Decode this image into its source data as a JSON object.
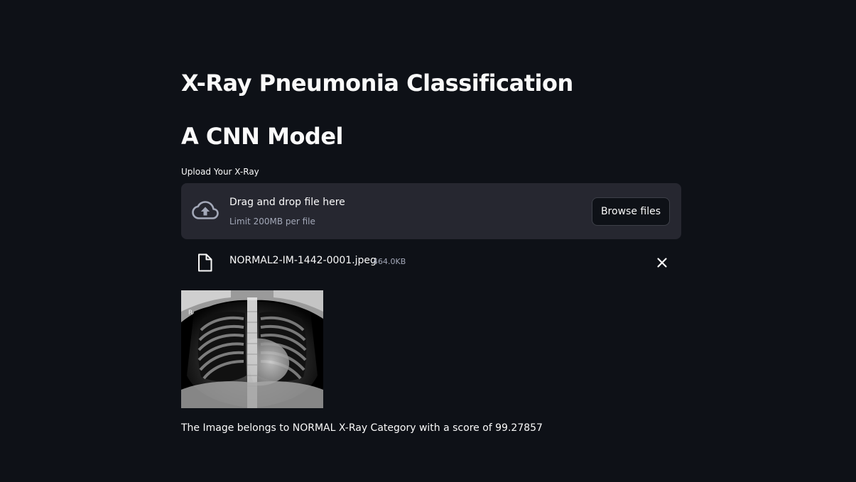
{
  "page": {
    "title": "X-Ray Pneumonia Classification",
    "subtitle": "A CNN Model"
  },
  "uploader": {
    "label": "Upload Your X-Ray",
    "drop_text": "Drag and drop file here",
    "limit_text": "Limit 200MB per file",
    "browse_label": "Browse files",
    "icon": "cloud-upload-icon"
  },
  "uploaded_file": {
    "name": "NORMAL2-IM-1442-0001.jpeg",
    "size": "464.0KB",
    "icon": "file-icon",
    "remove_icon": "close-icon"
  },
  "preview": {
    "marker": "R"
  },
  "result": {
    "text": "The Image belongs to NORMAL X-Ray Category with a score of 99.27857"
  },
  "colors": {
    "background": "#0e1117",
    "dropzone": "#262730",
    "text": "#fafafa",
    "muted_text": "#a3a8b8"
  }
}
